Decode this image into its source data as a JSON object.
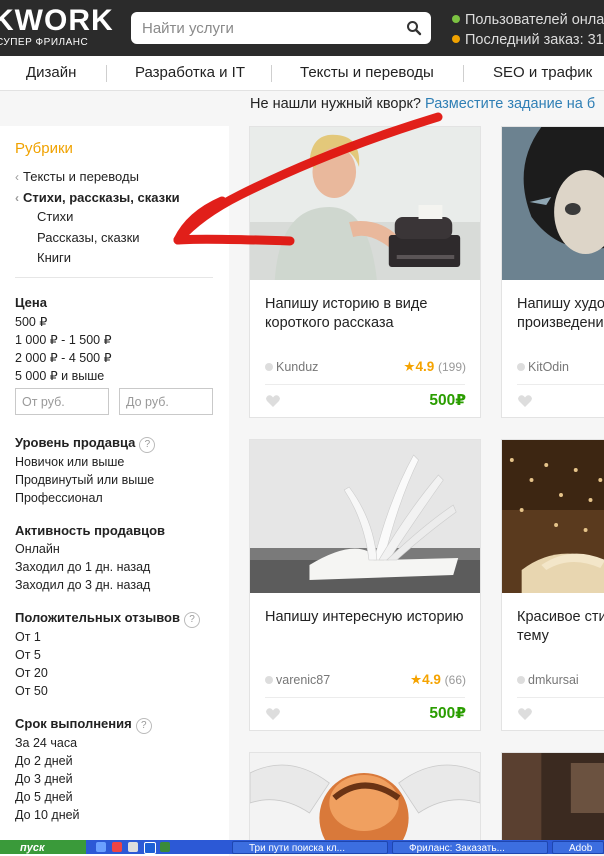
{
  "header": {
    "logo": "KWORK",
    "logo_sub": "СУПЕР ФРИЛАНС",
    "search_placeholder": "Найти услуги",
    "stats": [
      "Пользователей онла",
      "Последний заказ: 31"
    ],
    "stats_colors": [
      "#7cc242",
      "#f0a200"
    ]
  },
  "nav": [
    "Дизайн",
    "Разработка и IT",
    "Тексты и переводы",
    "SEO и трафик"
  ],
  "notice": {
    "text": "Не нашли нужный кворк?",
    "link": "Разместите задание на б"
  },
  "sidebar": {
    "title": "Рубрики",
    "parent": "Тексты и переводы",
    "current": "Стихи, рассказы, сказки",
    "children": [
      "Стихи",
      "Рассказы, сказки",
      "Книги"
    ],
    "price": {
      "title": "Цена",
      "options": [
        "500 ₽",
        "1 000 ₽ - 1 500 ₽",
        "2 000 ₽ - 4 500 ₽",
        "5 000 ₽ и выше"
      ],
      "from_placeholder": "От руб.",
      "to_placeholder": "До руб."
    },
    "level": {
      "title": "Уровень продавца",
      "options": [
        "Новичок или выше",
        "Продвинутый или выше",
        "Профессионал"
      ]
    },
    "activity": {
      "title": "Активность продавцов",
      "options": [
        "Онлайн",
        "Заходил до 1 дн. назад",
        "Заходил до 3 дн. назад"
      ]
    },
    "reviews": {
      "title": "Положительных отзывов",
      "options": [
        "От 1",
        "От 5",
        "От 20",
        "От 50"
      ]
    },
    "deadline": {
      "title": "Срок выполнения",
      "options": [
        "За 24 часа",
        "До 2 дней",
        "До 3 дней",
        "До 5 дней",
        "До 10 дней"
      ]
    }
  },
  "cards": [
    {
      "title": "Напишу историю в виде короткого рассказа",
      "seller": "Kunduz",
      "rating": "4.9",
      "reviews": "(199)",
      "price": "500₽"
    },
    {
      "title": "Напишу худо произведени",
      "seller": "KitOdin",
      "rating": "",
      "reviews": "",
      "price": ""
    },
    {
      "title": "Напишу интересную историю",
      "seller": "varenic87",
      "rating": "4.9",
      "reviews": "(66)",
      "price": "500₽"
    },
    {
      "title": "Красивое сти Вашу тему",
      "seller": "dmkursai",
      "rating": "",
      "reviews": "",
      "price": ""
    }
  ],
  "taskbar": {
    "start": "пуск",
    "tasks": [
      "Три пути поиска кл...",
      "Фриланс: Заказать...",
      "Adob"
    ]
  }
}
